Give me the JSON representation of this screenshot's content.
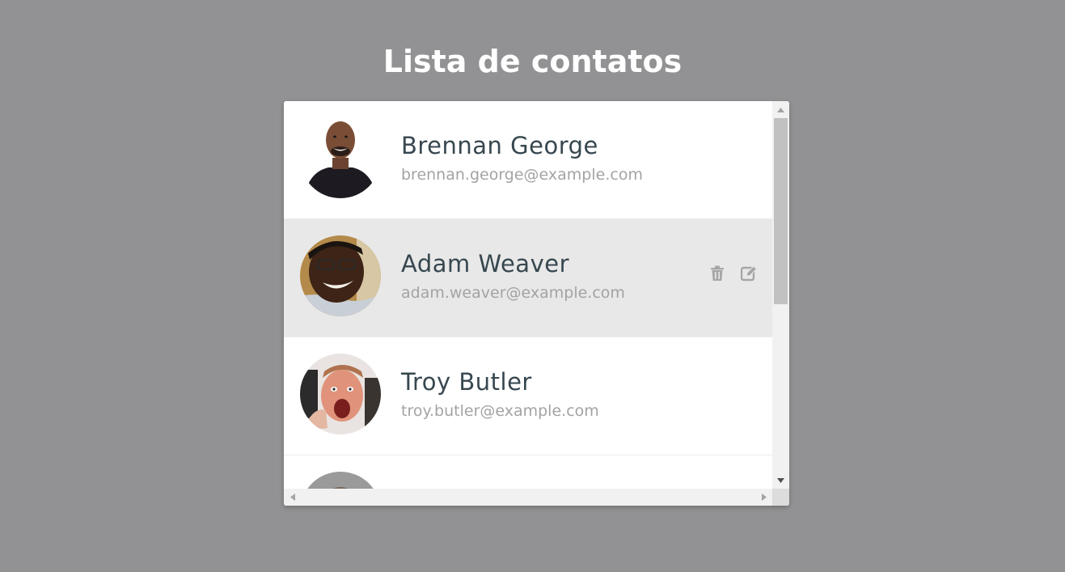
{
  "header": {
    "title": "Lista de contatos"
  },
  "contacts": [
    {
      "name": "Brennan George",
      "email": "brennan.george@example.com",
      "avatar": "person-avatar-1"
    },
    {
      "name": "Adam Weaver",
      "email": "adam.weaver@example.com",
      "avatar": "person-avatar-2"
    },
    {
      "name": "Troy Butler",
      "email": "troy.butler@example.com",
      "avatar": "person-avatar-3"
    }
  ],
  "row_actions": {
    "delete_icon": "trash-icon",
    "edit_icon": "edit-icon"
  },
  "colors": {
    "background": "#929294",
    "card": "#ffffff",
    "row_hover": "#e8e8e8",
    "name_text": "#37474f",
    "email_text": "#a3a3a3",
    "action_icon": "#a6a6a6"
  }
}
